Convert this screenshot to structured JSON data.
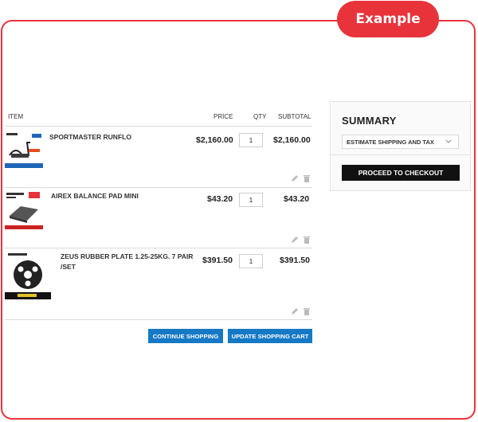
{
  "badge": "Example",
  "columns": {
    "item": "ITEM",
    "price": "PRICE",
    "qty": "QTY",
    "subtotal": "SUBTOTAL"
  },
  "items": [
    {
      "name": "SPORTMASTER RUNFLO",
      "price": "$2,160.00",
      "qty": "1",
      "subtotal": "$2,160.00"
    },
    {
      "name": "AIREX BALANCE PAD MINI",
      "price": "$43.20",
      "qty": "1",
      "subtotal": "$43.20"
    },
    {
      "name_line1": "ZEUS RUBBER PLATE 1.25-25KG. 7 PAIR",
      "name_line2": "/SET",
      "price": "$391.50",
      "qty": "1",
      "subtotal": "$391.50"
    }
  ],
  "actions": {
    "continue": "CONTINUE SHOPPING",
    "update": "UPDATE SHOPPING CART"
  },
  "summary": {
    "title": "SUMMARY",
    "shipping": "ESTIMATE SHIPPING AND TAX",
    "checkout": "PROCEED TO CHECKOUT"
  },
  "colors": {
    "brand_red": "#e8333b",
    "button_blue": "#1679c5",
    "checkout_black": "#111111"
  },
  "icons": [
    "edit-icon",
    "delete-icon",
    "chevron-down-icon"
  ]
}
